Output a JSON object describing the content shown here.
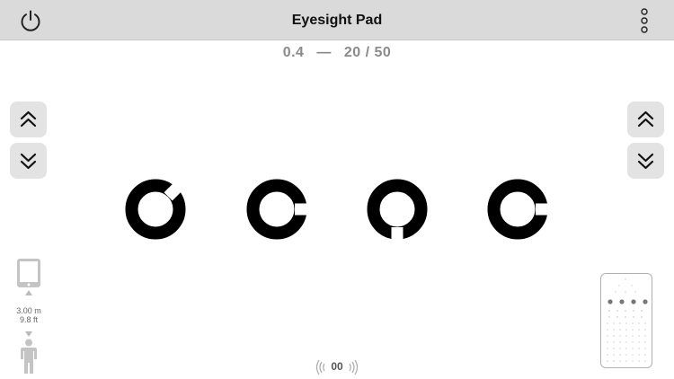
{
  "header": {
    "title": "Eyesight Pad",
    "power_icon": "power-icon",
    "menu_icon": "vertical-dots-icon"
  },
  "acuity": {
    "decimal": "0.4",
    "separator": "—",
    "snellen": "20 / 50"
  },
  "left_controls": {
    "up_icon": "double-chevron-up-icon",
    "down_icon": "double-chevron-down-icon"
  },
  "right_controls": {
    "up_icon": "double-chevron-up-icon",
    "down_icon": "double-chevron-down-icon"
  },
  "optotypes": [
    {
      "symbol": "landolt-ring",
      "gap_direction": "up-left"
    },
    {
      "symbol": "landolt-ring",
      "gap_direction": "right"
    },
    {
      "symbol": "landolt-ring",
      "gap_direction": "down"
    },
    {
      "symbol": "landolt-ring",
      "gap_direction": "right"
    }
  ],
  "distance": {
    "meters": "3.00 m",
    "feet": "9.8 ft",
    "device_icon": "tablet-icon",
    "person_icon": "person-icon"
  },
  "sound": {
    "label": "00",
    "icon": "sound-waves-icon"
  },
  "mini_chart": {
    "icon": "chart-preview-thumbnail"
  },
  "colors": {
    "topbar": "#dadada",
    "button": "#e3e3e3",
    "optotype": "#000000",
    "muted_text": "#8a8a8a"
  }
}
